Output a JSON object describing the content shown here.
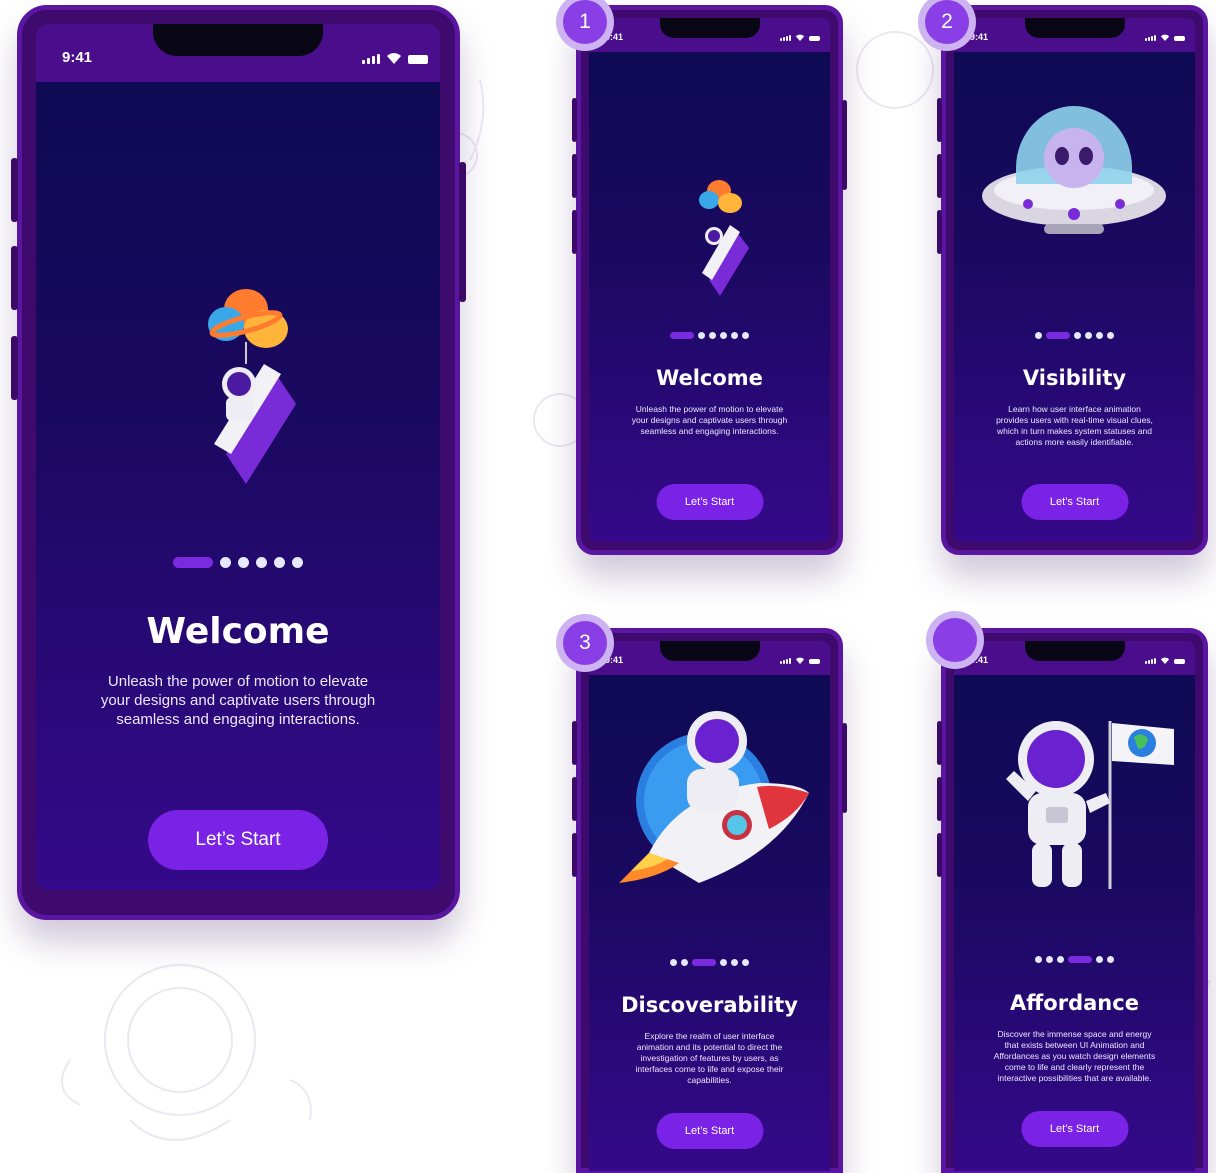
{
  "colors": {
    "frame": "#3e0a6e",
    "status_bar": "#4a0e8c",
    "screen_top": "#0c0a52",
    "screen_bottom": "#35098a",
    "accent": "#7a22e6",
    "dot_inactive": "#e6e9fb"
  },
  "status_icons": [
    "signal-icon",
    "wifi-icon",
    "battery-icon"
  ],
  "screens": [
    {
      "time": "9:41",
      "illustration": "astronaut-with-planet-balloons",
      "title": "Welcome",
      "description": "Unleash the power of motion to elevate your designs and captivate users through seamless and engaging interactions.",
      "button": "Let’s Start",
      "page_count": 6,
      "active_page": 1
    },
    {
      "badge": "1",
      "time": "9:41",
      "illustration": "astronaut-with-planet-balloons",
      "title": "Welcome",
      "description": "Unleash the power of motion to elevate your designs and captivate users through seamless and engaging interactions.",
      "button": "Let’s Start",
      "page_count": 6,
      "active_page": 1
    },
    {
      "badge": "2",
      "time": "9:41",
      "illustration": "alien-in-ufo",
      "title": "Visibility",
      "description": "Learn how user interface animation provides users with real-time visual clues, which in turn makes system statuses and actions more easily identifiable.",
      "button": "Let’s Start",
      "page_count": 6,
      "active_page": 2
    },
    {
      "badge": "3",
      "time": "9:41",
      "illustration": "astronaut-riding-rocket",
      "title": "Discoverability",
      "description": "Explore the realm of user interface animation and its potential to direct the investigation of features by users, as interfaces come to life and expose their capabilities.",
      "button": "Let’s Start",
      "page_count": 6,
      "active_page": 3
    },
    {
      "badge": "",
      "time": "9:41",
      "illustration": "astronaut-with-earth-flag",
      "title": "Affordance",
      "description": "Discover the immense space and energy that exists between UI Animation and Affordances as you watch design elements come to life and clearly represent the interactive possibilities that are available.",
      "button": "Let’s Start",
      "page_count": 6,
      "active_page": 4
    }
  ]
}
